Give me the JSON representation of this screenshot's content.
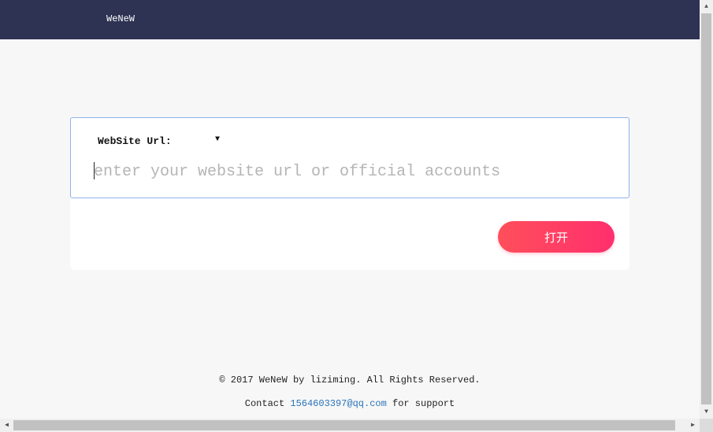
{
  "header": {
    "brand": "WeNeW",
    "background_color": "#2e3253"
  },
  "form": {
    "label": "WebSite Url:",
    "dropdown_icon": "caret-down-icon",
    "input_value": "",
    "input_placeholder": "enter your website url or official accounts",
    "open_button_label": "打开",
    "button_color": "#ff3a66",
    "focus_border_color": "#8fb3ea"
  },
  "footer": {
    "copyright": "© 2017 WeNeW by liziming. All Rights Reserved.",
    "contact_prefix": "Contact ",
    "contact_email": "1564603397@qq.com",
    "contact_suffix": " for support",
    "link_color": "#2a74b8"
  },
  "scrollbars": {
    "up_icon": "▲",
    "down_icon": "▼",
    "left_icon": "◀",
    "right_icon": "▶"
  }
}
